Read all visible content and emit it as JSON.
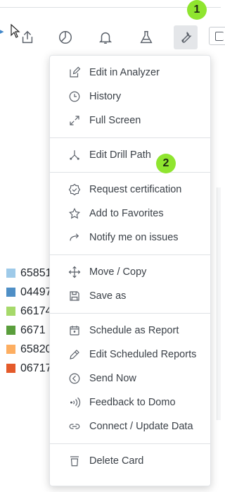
{
  "toolbar": {
    "icons": [
      "share-icon",
      "chart-pie-icon",
      "bell-icon",
      "flask-icon",
      "wrench-icon",
      "copy-icon"
    ]
  },
  "badges": {
    "one": "1",
    "two": "2"
  },
  "legend": {
    "items": [
      {
        "label": "65851",
        "color": "#9ecae9"
      },
      {
        "label": "04497",
        "color": "#4f8fc6"
      },
      {
        "label": "66174",
        "color": "#a6d96a"
      },
      {
        "label": "6671",
        "color": "#5a9e3c"
      },
      {
        "label": "65820",
        "color": "#fdae61"
      },
      {
        "label": "06717",
        "color": "#e45a2a"
      }
    ]
  },
  "menu": {
    "sections": [
      {
        "items": [
          {
            "label": "Edit in Analyzer",
            "icon": "edit-icon"
          },
          {
            "label": "History",
            "icon": "clock-icon"
          },
          {
            "label": "Full Screen",
            "icon": "expand-icon"
          }
        ]
      },
      {
        "items": [
          {
            "label": "Edit Drill Path",
            "icon": "drill-path-icon"
          }
        ]
      },
      {
        "items": [
          {
            "label": "Request certification",
            "icon": "certification-icon"
          },
          {
            "label": "Add to Favorites",
            "icon": "star-icon"
          },
          {
            "label": "Notify me on issues",
            "icon": "arrow-curve-icon"
          }
        ]
      },
      {
        "items": [
          {
            "label": "Move / Copy",
            "icon": "move-icon"
          },
          {
            "label": "Save as",
            "icon": "save-icon"
          }
        ]
      },
      {
        "items": [
          {
            "label": "Schedule as Report",
            "icon": "calendar-icon"
          },
          {
            "label": "Edit Scheduled Reports",
            "icon": "pencil-icon"
          },
          {
            "label": "Send Now",
            "icon": "send-now-icon"
          },
          {
            "label": "Feedback to Domo",
            "icon": "feedback-icon"
          },
          {
            "label": "Connect / Update Data",
            "icon": "link-icon"
          }
        ]
      },
      {
        "items": [
          {
            "label": "Delete Card",
            "icon": "trash-icon"
          }
        ]
      }
    ]
  }
}
